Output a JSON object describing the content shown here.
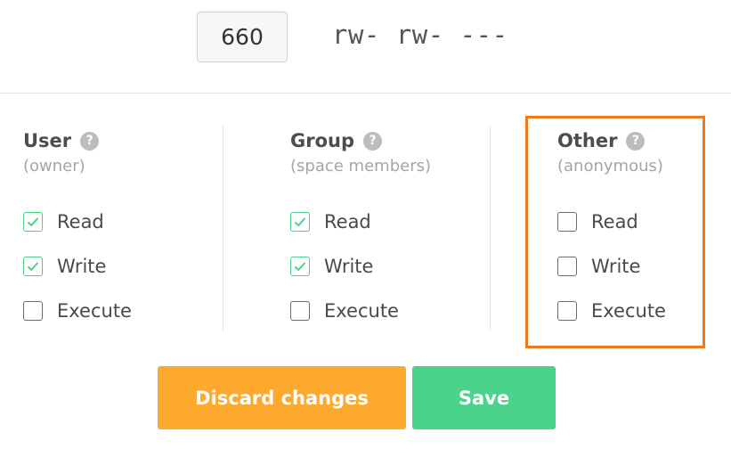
{
  "octal": {
    "value": "660"
  },
  "symbolic": "rw- rw- ---",
  "groups": [
    {
      "title": "User",
      "subtitle": "(owner)",
      "help_icon": "question-mark-icon",
      "perms": [
        {
          "label": "Read",
          "checked": true
        },
        {
          "label": "Write",
          "checked": true
        },
        {
          "label": "Execute",
          "checked": false
        }
      ]
    },
    {
      "title": "Group",
      "subtitle": "(space members)",
      "help_icon": "question-mark-icon",
      "perms": [
        {
          "label": "Read",
          "checked": true
        },
        {
          "label": "Write",
          "checked": true
        },
        {
          "label": "Execute",
          "checked": false
        }
      ]
    },
    {
      "title": "Other",
      "subtitle": "(anonymous)",
      "help_icon": "question-mark-icon",
      "perms": [
        {
          "label": "Read",
          "checked": false
        },
        {
          "label": "Write",
          "checked": false
        },
        {
          "label": "Execute",
          "checked": false
        }
      ]
    }
  ],
  "buttons": {
    "discard_label": "Discard changes",
    "save_label": "Save"
  },
  "colors": {
    "check": "#4ccf8a",
    "discard": "#fda92e",
    "save": "#4bd28b",
    "highlight": "#ef7a1a"
  },
  "help_glyph": "?"
}
